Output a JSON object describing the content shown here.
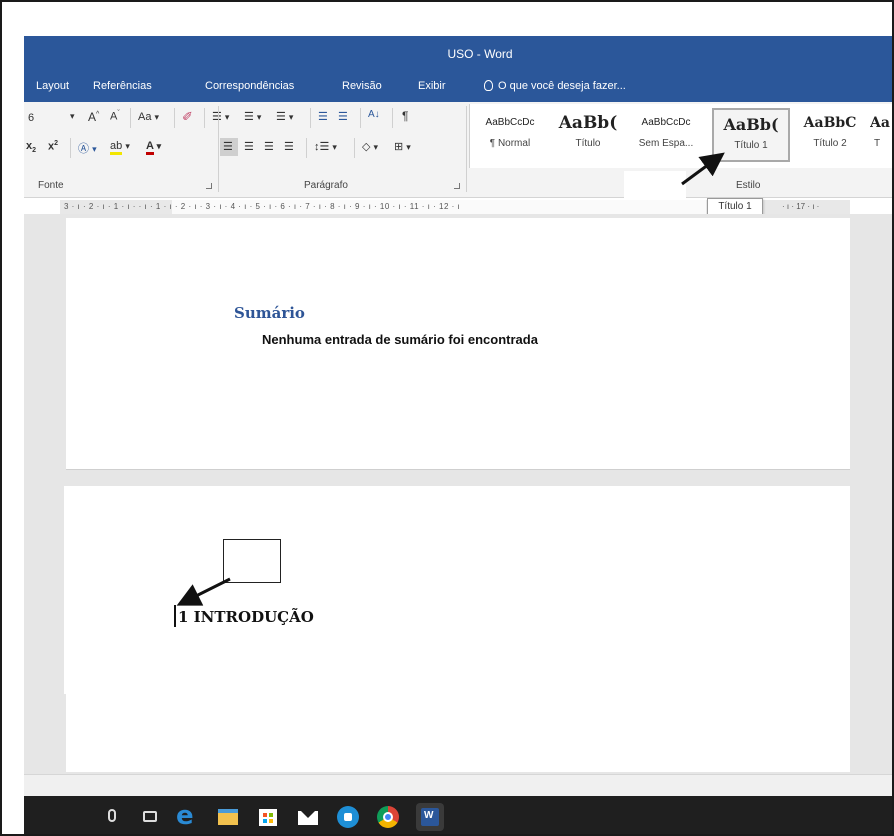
{
  "window": {
    "title": "USO - Word"
  },
  "menu": {
    "tabs": [
      "Layout",
      "Referências",
      "Correspondências",
      "Revisão",
      "Exibir"
    ],
    "tell_me": "O que você deseja fazer..."
  },
  "ribbon": {
    "font": {
      "size_value": "6",
      "change_case": "Aa",
      "group_label": "Fonte"
    },
    "paragraph": {
      "group_label": "Parágrafo"
    },
    "styles": {
      "group_label": "Estilo",
      "items": [
        {
          "sample": "AaBbCcDc",
          "name": "¶ Normal"
        },
        {
          "sample": "AaBb(",
          "name": "Título"
        },
        {
          "sample": "AaBbCcDc",
          "name": "Sem Espa..."
        },
        {
          "sample": "AaBb(",
          "name": "Título 1"
        },
        {
          "sample": "AaBbC",
          "name": "Título 2"
        },
        {
          "sample": "Aa",
          "name": "T"
        }
      ]
    },
    "tooltip": "Título 1"
  },
  "ruler": {
    "marks": "3 · ı · 2 · ı · 1 · ı ·   · ı · 1 · ı · 2 · ı · 3 · ı · 4 · ı · 5 · ı · 6 · ı · 7 · ı · 8 · ı · 9 · ı · 10 · ı · 11 · ı · 12 · ı",
    "marks_right": "· ı · 17 · ı ·"
  },
  "document": {
    "page1": {
      "toc_title": "Sumário",
      "toc_message": "Nenhuma entrada de sumário foi encontrada"
    },
    "page2": {
      "heading": "1 INTRODUÇÃO"
    }
  },
  "colors": {
    "word_blue": "#2b579a",
    "heading_blue": "#2e5597",
    "taskbar": "#1f1f1f"
  },
  "taskbar": {
    "icons": [
      "microphone-icon",
      "task-view-icon",
      "edge-icon",
      "file-explorer-icon",
      "store-icon",
      "mail-icon",
      "app-icon",
      "chrome-icon",
      "word-icon"
    ]
  }
}
